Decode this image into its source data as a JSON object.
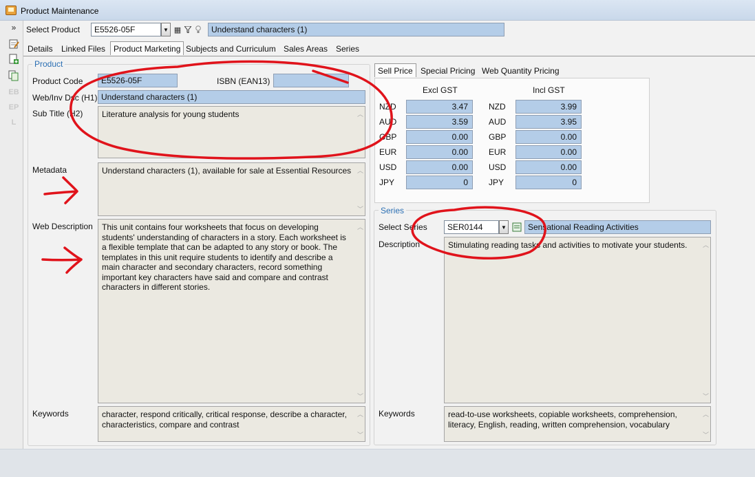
{
  "window": {
    "title": "Product Maintenance"
  },
  "toolbar": {
    "expand_icon": "»",
    "select_product_label": "Select Product",
    "product_code_value": "E5526-05F",
    "product_name_value": "Understand characters (1)"
  },
  "tabs": [
    "Details",
    "Linked Files",
    "Product Marketing",
    "Subjects and Curriculum",
    "Sales Areas",
    "Series"
  ],
  "active_tab": "Product Marketing",
  "product_group": {
    "title": "Product",
    "product_code_label": "Product Code",
    "product_code_value": "E5526-05F",
    "isbn_label": "ISBN (EAN13)",
    "isbn_value": "",
    "web_inv_dsc_label": "Web/Inv Dsc (H1)",
    "web_inv_dsc_value": "Understand characters (1)",
    "sub_title_label": "Sub Title (H2)",
    "sub_title_value": "Literature analysis for young students",
    "metadata_label": "Metadata",
    "metadata_value": "Understand characters (1), available for sale at Essential Resources",
    "web_description_label": "Web Description",
    "web_description_value": "This unit contains four worksheets that focus on developing students' understanding of characters in a story. Each worksheet is a flexible template that can be adapted to any story or book. The templates in this unit require students to identify and describe a main character and secondary characters, record something important key characters have said and compare and contrast characters in different stories.",
    "keywords_label": "Keywords",
    "keywords_value": "character, respond critically, critical response, describe a character, characteristics, compare and contrast"
  },
  "pricing": {
    "tabs": [
      "Sell Price",
      "Special Pricing",
      "Web Quantity Pricing"
    ],
    "active_tab": "Sell Price",
    "excl_header": "Excl GST",
    "incl_header": "Incl GST",
    "rows": [
      {
        "currency": "NZD",
        "excl": "3.47",
        "incl": "3.99"
      },
      {
        "currency": "AUD",
        "excl": "3.59",
        "incl": "3.95"
      },
      {
        "currency": "GBP",
        "excl": "0.00",
        "incl": "0.00"
      },
      {
        "currency": "EUR",
        "excl": "0.00",
        "incl": "0.00"
      },
      {
        "currency": "USD",
        "excl": "0.00",
        "incl": "0.00"
      },
      {
        "currency": "JPY",
        "excl": "0",
        "incl": "0"
      }
    ]
  },
  "series_group": {
    "title": "Series",
    "select_series_label": "Select Series",
    "series_code_value": "SER0144",
    "series_name_value": "Sensational Reading Activities",
    "description_label": "Description",
    "description_value": "Stimulating reading tasks and activities to motivate your students.",
    "keywords_label": "Keywords",
    "keywords_value": "read-to-use worksheets, copiable worksheets, comprehension, literacy, English, reading, written comprehension, vocabulary"
  },
  "left_toolbar": {
    "disabled_labels": [
      "EB",
      "EP",
      "L"
    ]
  },
  "colors": {
    "field_blue": "#b4cde8",
    "group_title": "#2b6fb3",
    "annotation_red": "#e0131b"
  }
}
